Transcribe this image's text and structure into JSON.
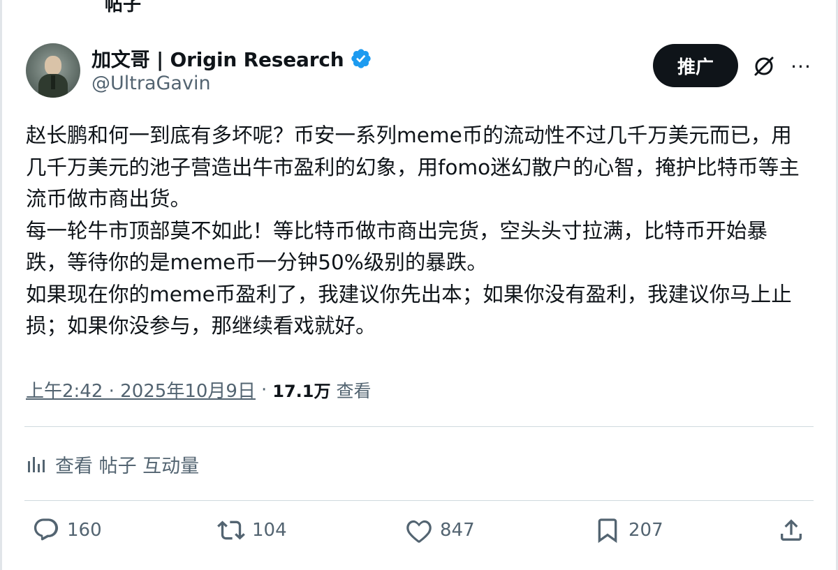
{
  "header": {
    "top_cut_text": "帖子"
  },
  "author": {
    "display_name": "加文哥 | Origin Research",
    "handle": "@UltraGavin",
    "verified": true
  },
  "toolbar": {
    "promote_label": "推广",
    "more_label": "···"
  },
  "tweet": {
    "paragraphs": [
      "赵长鹏和何一到底有多坏呢？币安一系列meme币的流动性不过几千万美元而已，用几千万美元的池子营造出牛市盈利的幻象，用fomo迷幻散户的心智，掩护比特币等主流币做市商出货。",
      "每一轮牛市顶部莫不如此！等比特币做市商出完货，空头头寸拉满，比特币开始暴跌，等待你的是meme币一分钟50%级别的暴跌。",
      "如果现在你的meme币盈利了，我建议你先出本；如果你没有盈利，我建议你马上止损；如果你没参与，那继续看戏就好。"
    ],
    "timestamp": "上午2:42 · 2025年10月9日",
    "separator": "·",
    "views_count": "17.1万",
    "views_label": "查看"
  },
  "analytics": {
    "label": "查看 帖子 互动量"
  },
  "actions": {
    "reply_count": "160",
    "retweet_count": "104",
    "like_count": "847",
    "bookmark_count": "207"
  },
  "colors": {
    "text_primary": "#0f1419",
    "text_secondary": "#536471",
    "verified_blue": "#1d9bf0",
    "divider": "#cfd9de",
    "button_dark": "#0f1419"
  }
}
